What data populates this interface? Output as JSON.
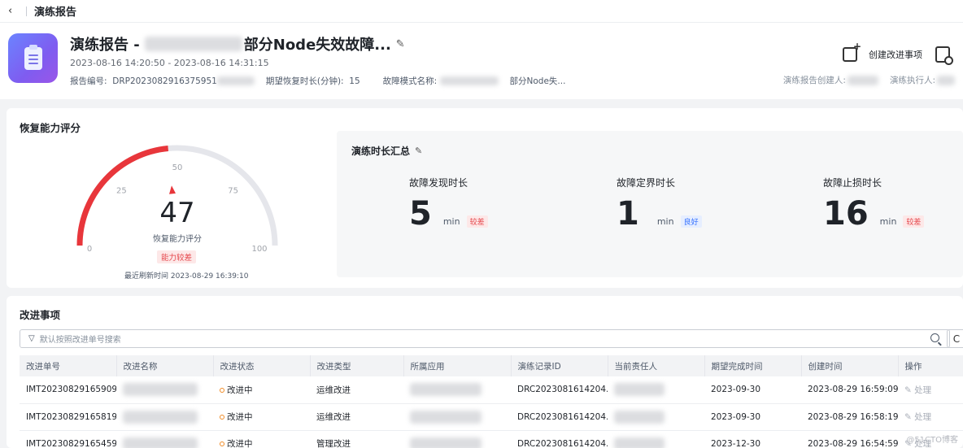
{
  "topbar": {
    "back_icon": "‹",
    "title": "演练报告"
  },
  "header": {
    "title_prefix": "演练报告 -",
    "title_suffix": "部分Node失效故障...",
    "time_range": "2023-08-16 14:20:50 - 2023-08-16 14:31:15",
    "report_no_label": "报告编号:",
    "report_no_value": "DRP2023082916375951",
    "expected_recovery_label": "期望恢复时长(分钟):",
    "expected_recovery_value": "15",
    "fault_mode_label": "故障模式名称:",
    "fault_mode_value": "部分Node失...",
    "create_improvement": "创建改进事项",
    "creator_label": "演练报告创建人:",
    "executor_label": "演练执行人:"
  },
  "recovery": {
    "title": "恢复能力评分",
    "score": "47",
    "label": "恢复能力评分",
    "badge": "能力较差",
    "refresh_time": "最近刷新时间 2023-08-29 16:39:10",
    "ticks": [
      "0",
      "25",
      "50",
      "75",
      "100"
    ],
    "score_value": 47,
    "color_active": "#e8363b",
    "color_track": "#e5e6eb"
  },
  "duration": {
    "title": "演练时长汇总",
    "metrics": [
      {
        "label": "故障发现时长",
        "value": "5",
        "unit": "min",
        "tag": "较差"
      },
      {
        "label": "故障定界时长",
        "value": "1",
        "unit": "min",
        "tag": "良好"
      },
      {
        "label": "故障止损时长",
        "value": "16",
        "unit": "min",
        "tag": "较差"
      }
    ]
  },
  "improvements": {
    "title": "改进事项",
    "search_placeholder": "默认按照改进单号搜索",
    "columns": [
      "改进单号",
      "改进名称",
      "改进状态",
      "改进类型",
      "所属应用",
      "演练记录ID",
      "当前责任人",
      "期望完成时间",
      "创建时间",
      "操作"
    ],
    "rows": [
      {
        "id": "IMT20230829165909...",
        "status": "改进中",
        "type": "运维改进",
        "record": "DRC2023081614204...",
        "due": "2023-09-30",
        "created": "2023-08-29 16:59:09...",
        "action": "处理"
      },
      {
        "id": "IMT20230829165819...",
        "status": "改进中",
        "type": "运维改进",
        "record": "DRC2023081614204...",
        "due": "2023-09-30",
        "created": "2023-08-29 16:58:19...",
        "action": "处理"
      },
      {
        "id": "IMT20230829165459...",
        "status": "改进中",
        "type": "管理改进",
        "record": "DRC2023081614204...",
        "due": "2023-12-30",
        "created": "2023-08-29 16:54:59...",
        "action": "处理"
      }
    ]
  },
  "watermark": "@51CTO博客"
}
